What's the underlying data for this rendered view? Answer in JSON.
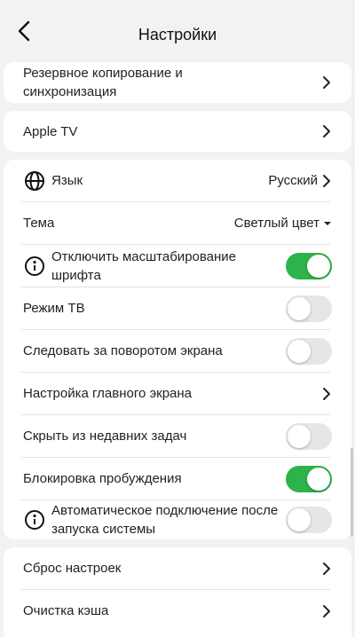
{
  "header": {
    "title": "Настройки",
    "back_icon": "chevron-left-icon"
  },
  "rows": {
    "backup": "Резервное копирование и синхронизация",
    "apple_tv": "Apple TV",
    "language_label": "Язык",
    "language_value": "Русский",
    "theme_label": "Тема",
    "theme_value": "Светлый цвет",
    "disable_font_scaling": "Отключить масштабирование шрифта",
    "tv_mode": "Режим TB",
    "follow_rotation": "Следовать за поворотом экрана",
    "home_screen_settings": "Настройка главного экрана",
    "hide_recent_tasks": "Скрыть из недавних задач",
    "wake_lock": "Блокировка пробуждения",
    "auto_connect": "Автоматическое подключение после запуска системы",
    "reset_settings": "Сброс настроек",
    "clear_cache": "Очистка кэша"
  },
  "toggles": {
    "disable_font_scaling": true,
    "tv_mode": false,
    "follow_rotation": false,
    "hide_recent_tasks": false,
    "wake_lock": true,
    "auto_connect": false
  },
  "colors": {
    "accent": "#2cb34a",
    "toggle_off": "#e6e6e6",
    "background": "#f2f2f2"
  }
}
